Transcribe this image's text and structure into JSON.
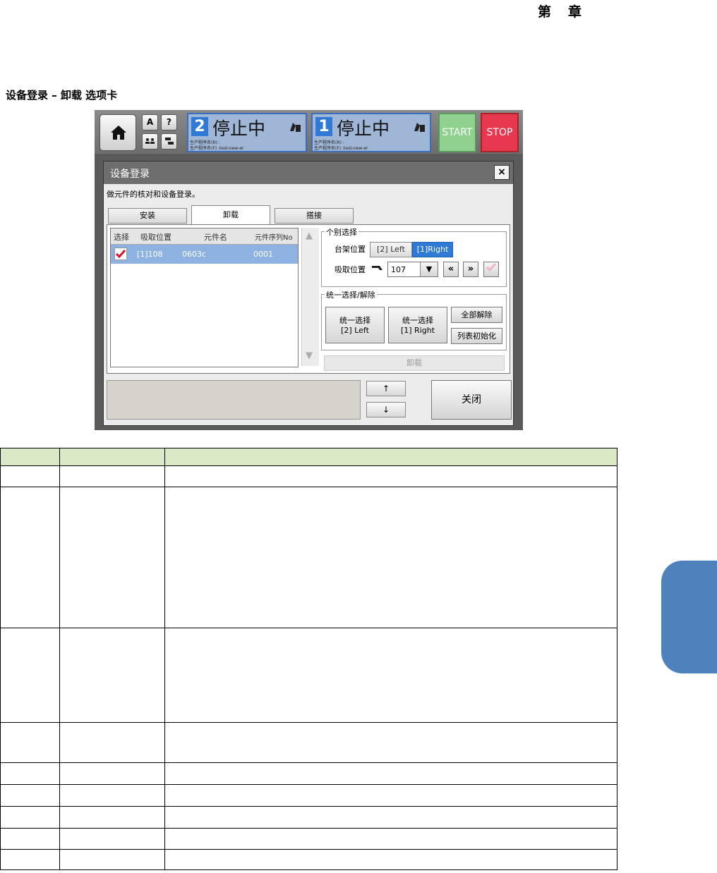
{
  "header": {
    "chapter_prefix": "第",
    "chapter_suffix": "章"
  },
  "section_title": "设备登录 – 卸载 选项卡",
  "topbar": {
    "small_btn_1": "A",
    "small_btn_2": "?",
    "lane2": {
      "number": "2",
      "state": "停止中",
      "sub1": "生产程序名(R) :",
      "sub2": "生产程序名(F) :test-new-er"
    },
    "lane1": {
      "number": "1",
      "state": "停止中",
      "sub1": "生产程序名(R) :",
      "sub2": "生产程序名(F) :test-new-er"
    },
    "start_label": "START",
    "stop_label": "STOP"
  },
  "dialog": {
    "title": "设备登录",
    "close_symbol": "×",
    "instruction": "做元件的核对和设备登录。",
    "tabs": [
      "安装",
      "卸载",
      "搭接"
    ],
    "grid": {
      "columns": [
        "选择",
        "吸取位置",
        "元件名",
        "元件序列No"
      ],
      "rows": [
        {
          "position": "[1]108",
          "part": "0603c",
          "serial": "0001",
          "selected": true
        }
      ],
      "scroll_up": "▲",
      "scroll_down": "▼"
    },
    "individual": {
      "title": "个别选择",
      "rack_label": "台架位置",
      "rack_left": "[2] Left",
      "rack_right": "[1]Right",
      "pick_label": "吸取位置",
      "pick_value": "107",
      "dropdown_symbol": "▼",
      "prev_symbol": "«",
      "next_symbol": "»"
    },
    "batch": {
      "title": "统一选择/解除",
      "select_left_l1": "统一选择",
      "select_left_l2": "[2] Left",
      "select_right_l1": "统一选择",
      "select_right_l2": "[1] Right",
      "clear_all": "全部解除",
      "init_list": "列表初始化"
    },
    "unload_button": "卸载",
    "up_arrow": "↑",
    "down_arrow": "↓",
    "close_button": "关闭"
  },
  "colors": {
    "accent": "#2f7ad6",
    "start": "#8fd18f",
    "stop": "#e8384f",
    "table_header": "#dbe9c6",
    "side_tab": "#4f81bd"
  }
}
